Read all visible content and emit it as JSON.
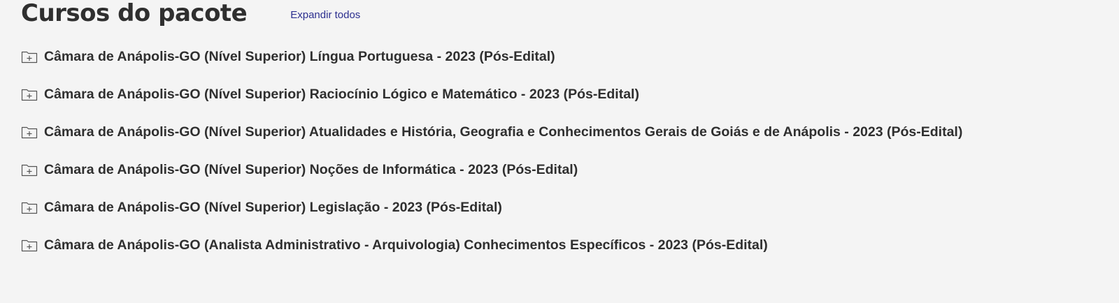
{
  "header": {
    "title": "Cursos do pacote",
    "expand_all_label": "Expandir todos"
  },
  "courses": [
    {
      "title": "Câmara de Anápolis-GO (Nível Superior) Língua Portuguesa - 2023 (Pós-Edital)",
      "icon": "folder-plus-icon"
    },
    {
      "title": "Câmara de Anápolis-GO (Nível Superior) Raciocínio Lógico e Matemático - 2023 (Pós-Edital)",
      "icon": "folder-plus-icon"
    },
    {
      "title": "Câmara de Anápolis-GO (Nível Superior) Atualidades e História, Geografia e Conhecimentos Gerais de Goiás e de Anápolis - 2023 (Pós-Edital)",
      "icon": "folder-plus-icon"
    },
    {
      "title": "Câmara de Anápolis-GO (Nível Superior) Noções de Informática - 2023 (Pós-Edital)",
      "icon": "folder-plus-icon"
    },
    {
      "title": "Câmara de Anápolis-GO (Nível Superior) Legislação - 2023 (Pós-Edital)",
      "icon": "folder-plus-icon"
    },
    {
      "title": "Câmara de Anápolis-GO (Analista Administrativo - Arquivologia) Conhecimentos Específicos - 2023 (Pós-Edital)",
      "icon": "folder-plus-icon"
    }
  ],
  "colors": {
    "background": "#f4f4f4",
    "text": "#2f2f2f",
    "link": "#2c2f8f"
  }
}
